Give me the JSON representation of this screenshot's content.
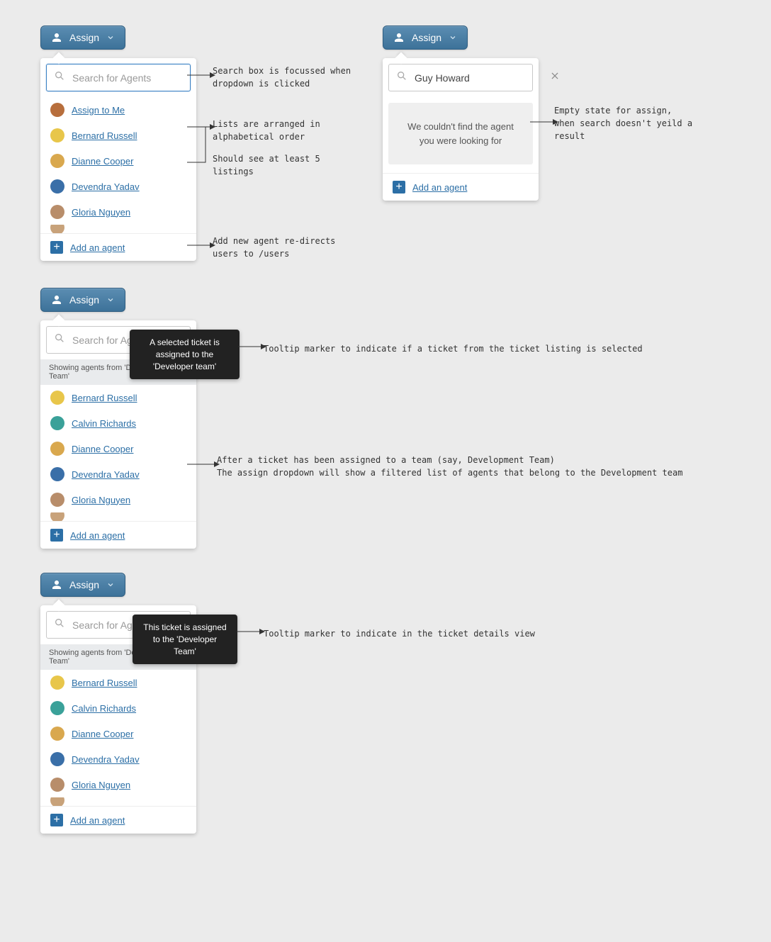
{
  "assign_label": "Assign",
  "search_placeholder": "Search for Agents",
  "add_agent_label": "Add an agent",
  "panel1": {
    "assign_to_me": "Assign to Me",
    "agents": [
      "Bernard Russell",
      "Dianne Cooper",
      "Devendra Yadav",
      "Gloria Nguyen"
    ]
  },
  "panel2": {
    "search_value": "Guy Howard",
    "empty_line1": "We couldn't find the agent",
    "empty_line2": "you were looking for"
  },
  "panel3": {
    "info_text": "Showing agents from 'Development Team'",
    "tooltip": "A selected ticket is assigned to the 'Developer team'",
    "agents": [
      "Bernard Russell",
      "Calvin Richards",
      "Dianne Cooper",
      "Devendra Yadav",
      "Gloria Nguyen"
    ]
  },
  "panel4": {
    "info_text": "Showing agents from 'Development Team'",
    "tooltip": "This ticket is assigned to the 'Developer Team'",
    "agents": [
      "Bernard Russell",
      "Calvin Richards",
      "Dianne Cooper",
      "Devendra Yadav",
      "Gloria Nguyen"
    ]
  },
  "ann": {
    "search_focus_1": "Search box is focussed when",
    "search_focus_2": "dropdown is clicked",
    "alpha_1": "Lists are arranged in",
    "alpha_2": "alphabetical order",
    "min5_1": "Should see at least 5",
    "min5_2": "listings",
    "add_new_1": "Add new agent re-directs",
    "add_new_2": "users to /users",
    "empty_1": "Empty state for assign,",
    "empty_2": "when search doesn't yeild a",
    "empty_3": "result",
    "tooltip_listing": "Tooltip marker to indicate if a ticket from the ticket listing is selected",
    "filtered_1": "After a ticket has been assigned to a team (say, Development Team)",
    "filtered_2": "The assign dropdown will show a filtered list of agents that belong to the Development team",
    "tooltip_details": "Tooltip marker to indicate in the ticket details view"
  },
  "avatars": {
    "me": "#b76e3c",
    "bernard": "#e8c64a",
    "dianne": "#d9a84e",
    "devendra": "#3a6fa8",
    "gloria": "#b88d6a",
    "calvin": "#3aa199"
  }
}
